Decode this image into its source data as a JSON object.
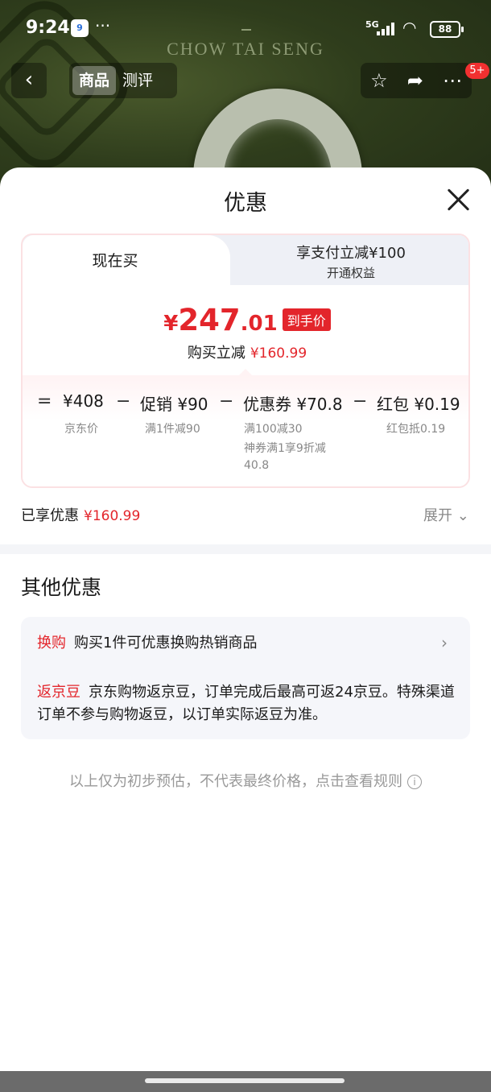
{
  "status_bar": {
    "time": "9:24",
    "app_badge": "9",
    "more": "···",
    "network": "5G",
    "battery": "88"
  },
  "brand": "CHOW TAI SENG",
  "nav": {
    "back_icon": "chevron-left-icon",
    "tabs": [
      "商品",
      "测评"
    ],
    "active_tab": "商品",
    "right_icons": [
      "star-icon",
      "share-icon",
      "more-icon"
    ],
    "message_badge": "5+"
  },
  "sheet": {
    "title": "优惠",
    "tabs": {
      "now": "现在买",
      "pay_title": "享支付立减¥100",
      "pay_sub": "开通权益"
    },
    "price": {
      "yen": "¥",
      "integer": "247",
      "decimal": ".01",
      "tag": "到手价",
      "reduce_label": "购买立减",
      "reduce_amount": "¥160.99"
    },
    "breakdown": {
      "eq": "=",
      "minus": "−",
      "items": [
        {
          "label": "¥408",
          "sub": "京东价"
        },
        {
          "label": "促销 ¥90",
          "sub": "满1件减90"
        },
        {
          "label": "优惠券 ¥70.8",
          "sub": "满100减30",
          "sub2": "神券满1享9折减",
          "sub3": "40.8"
        },
        {
          "label": "红包 ¥0.19",
          "sub": "红包抵0.19"
        }
      ]
    },
    "enjoyed_label": "已享优惠",
    "enjoyed_amount": "¥160.99",
    "expand": "展开"
  },
  "other": {
    "title": "其他优惠",
    "row1": {
      "tag": "换购",
      "text": "购买1件可优惠换购热销商品"
    },
    "row2": {
      "tag": "返京豆",
      "text": "京东购物返京豆，订单完成后最高可返24京豆。特殊渠道订单不参与购物返豆，以订单实际返豆为准。"
    }
  },
  "disclaimer": "以上仅为初步预估，不代表最终价格，点击查看规则",
  "colors": {
    "accent_red": "#e3252b",
    "bg_green": "#2f3d1c"
  }
}
